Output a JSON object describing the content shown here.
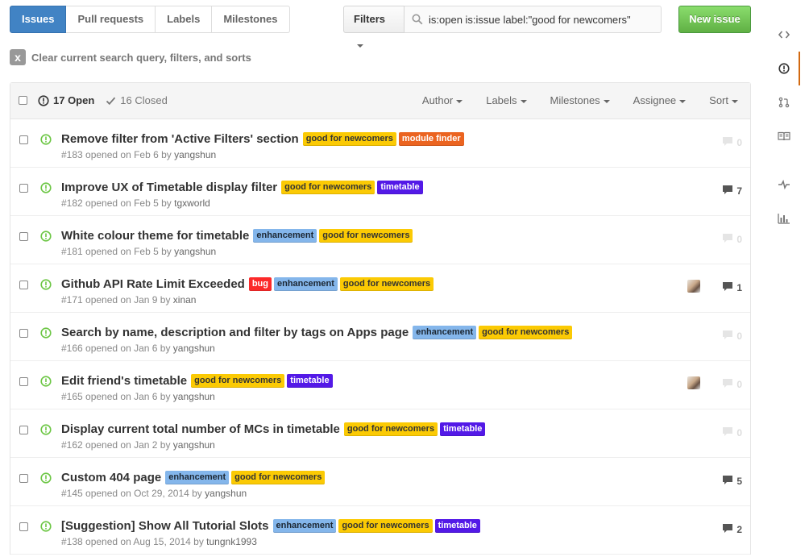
{
  "subnav": {
    "items": [
      {
        "label": "Issues",
        "selected": true
      },
      {
        "label": "Pull requests"
      },
      {
        "label": "Labels"
      },
      {
        "label": "Milestones"
      }
    ]
  },
  "filters": {
    "button_label": "Filters",
    "query": "is:open is:issue label:\"good for newcomers\""
  },
  "new_issue_label": "New issue",
  "clear_text": "Clear current search query, filters, and sorts",
  "clear_icon": "x",
  "header": {
    "open_label": "17 Open",
    "closed_label": "16 Closed",
    "filters": [
      "Author",
      "Labels",
      "Milestones",
      "Assignee",
      "Sort"
    ]
  },
  "label_colors": {
    "good for newcomers": {
      "bg": "#fbca04",
      "fg": "#333333"
    },
    "module finder": {
      "bg": "#eb6420",
      "fg": "#ffffff"
    },
    "timetable": {
      "bg": "#5319e7",
      "fg": "#ffffff"
    },
    "enhancement": {
      "bg": "#84b6eb",
      "fg": "#1c2733"
    },
    "bug": {
      "bg": "#fc2929",
      "fg": "#ffffff"
    }
  },
  "issues": [
    {
      "title": "Remove filter from 'Active Filters' section",
      "labels": [
        "good for newcomers",
        "module finder"
      ],
      "meta": "#183 opened on Feb 6 by ",
      "author": "yangshun",
      "comments": "0",
      "avatar": false
    },
    {
      "title": "Improve UX of Timetable display filter",
      "labels": [
        "good for newcomers",
        "timetable"
      ],
      "meta": "#182 opened on Feb 5 by ",
      "author": "tgxworld",
      "comments": "7",
      "avatar": false
    },
    {
      "title": "White colour theme for timetable",
      "labels": [
        "enhancement",
        "good for newcomers"
      ],
      "meta": "#181 opened on Feb 5 by ",
      "author": "yangshun",
      "comments": "0",
      "avatar": false
    },
    {
      "title": "Github API Rate Limit Exceeded",
      "labels": [
        "bug",
        "enhancement",
        "good for newcomers"
      ],
      "meta": "#171 opened on Jan 9 by ",
      "author": "xinan",
      "comments": "1",
      "avatar": true
    },
    {
      "title": "Search by name, description and filter by tags on Apps page",
      "labels": [
        "enhancement",
        "good for newcomers"
      ],
      "meta": "#166 opened on Jan 6 by ",
      "author": "yangshun",
      "comments": "0",
      "avatar": false
    },
    {
      "title": "Edit friend's timetable",
      "labels": [
        "good for newcomers",
        "timetable"
      ],
      "meta": "#165 opened on Jan 6 by ",
      "author": "yangshun",
      "comments": "0",
      "avatar": true
    },
    {
      "title": "Display current total number of MCs in timetable",
      "labels": [
        "good for newcomers",
        "timetable"
      ],
      "meta": "#162 opened on Jan 2 by ",
      "author": "yangshun",
      "comments": "0",
      "avatar": false
    },
    {
      "title": "Custom 404 page",
      "labels": [
        "enhancement",
        "good for newcomers"
      ],
      "meta": "#145 opened on Oct 29, 2014 by ",
      "author": "yangshun",
      "comments": "5",
      "avatar": false
    },
    {
      "title": "[Suggestion] Show All Tutorial Slots",
      "labels": [
        "enhancement",
        "good for newcomers",
        "timetable"
      ],
      "meta": "#138 opened on Aug 15, 2014 by ",
      "author": "tungnk1993",
      "comments": "2",
      "avatar": false
    }
  ],
  "sidenav": [
    "code-icon",
    "issues-icon",
    "pull-request-icon",
    "wiki-icon",
    "pulse-icon",
    "graphs-icon"
  ]
}
